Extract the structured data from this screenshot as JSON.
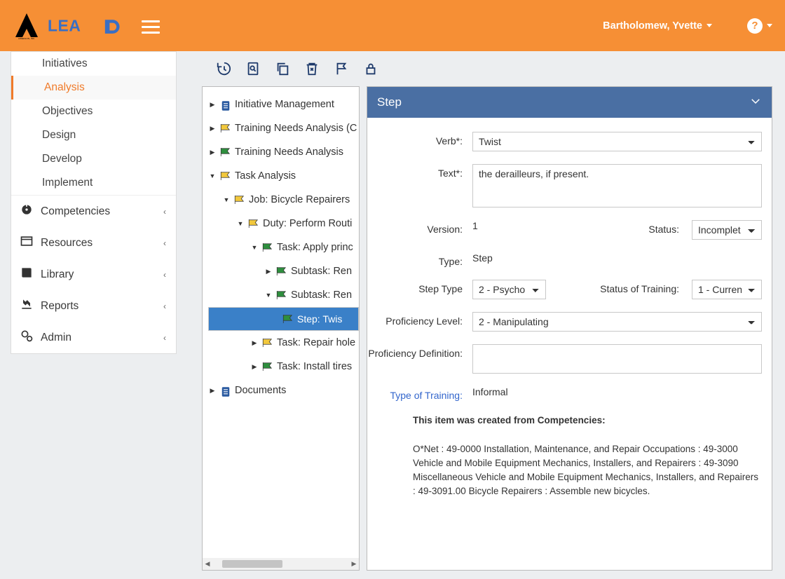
{
  "header": {
    "logo_tag": "AIMERLON, INC.",
    "user_name": "Bartholomew, Yvette"
  },
  "sidebar": {
    "sub": [
      "Initiatives",
      "Analysis",
      "Objectives",
      "Design",
      "Develop",
      "Implement"
    ],
    "active_index": 1,
    "main": [
      "Competencies",
      "Resources",
      "Library",
      "Reports",
      "Admin"
    ]
  },
  "tree": [
    {
      "depth": 0,
      "flag": "doc",
      "label": "Initiative Management",
      "twist": "▶"
    },
    {
      "depth": 0,
      "flag": "yellow",
      "label": "Training Needs Analysis (C",
      "twist": "▶"
    },
    {
      "depth": 0,
      "flag": "green",
      "label": "Training Needs Analysis",
      "twist": "▶"
    },
    {
      "depth": 0,
      "flag": "yellow",
      "label": "Task Analysis",
      "twist": "▼"
    },
    {
      "depth": 1,
      "flag": "yellow",
      "label": "Job: Bicycle Repairers",
      "twist": "▼"
    },
    {
      "depth": 2,
      "flag": "yellow",
      "label": "Duty: Perform Routi",
      "twist": "▼"
    },
    {
      "depth": 3,
      "flag": "green",
      "label": "Task: Apply princ",
      "twist": "▼"
    },
    {
      "depth": 4,
      "flag": "green",
      "label": "Subtask: Ren",
      "twist": "▶"
    },
    {
      "depth": 4,
      "flag": "green",
      "label": "Subtask: Ren",
      "twist": "▼"
    },
    {
      "depth": 5,
      "flag": "green",
      "label": "Step: Twis",
      "twist": "",
      "selected": true
    },
    {
      "depth": 3,
      "flag": "yellow",
      "label": "Task: Repair hole",
      "twist": "▶"
    },
    {
      "depth": 3,
      "flag": "green",
      "label": "Task: Install tires",
      "twist": "▶"
    },
    {
      "depth": 0,
      "flag": "doc",
      "label": "Documents",
      "twist": "▶"
    }
  ],
  "form": {
    "title": "Step",
    "verb_label": "Verb*:",
    "verb_value": "Twist",
    "text_label": "Text*:",
    "text_value": "the derailleurs, if present.",
    "version_label": "Version:",
    "version_value": "1",
    "status_label": "Status:",
    "status_value": "Incomplet",
    "type_label": "Type:",
    "type_value": "Step",
    "steptype_label": "Step Type",
    "steptype_value": "2 - Psycho",
    "sot_label": "Status of Training:",
    "sot_value": "1 - Curren",
    "prof_label": "Proficiency Level:",
    "prof_value": "2 - Manipulating",
    "profdef_label": "Proficiency Definition:",
    "profdef_value": "",
    "tot_label": "Type of Training:",
    "tot_value": "Informal",
    "note_head": "This item was created from Competencies:",
    "note_body": "O*Net : 49-0000 Installation, Maintenance, and Repair Occupations : 49-3000 Vehicle and Mobile Equipment Mechanics, Installers, and Repairers : 49-3090 Miscellaneous Vehicle and Mobile Equipment Mechanics, Installers, and Repairers : 49-3091.00 Bicycle Repairers : Assemble new bicycles."
  }
}
